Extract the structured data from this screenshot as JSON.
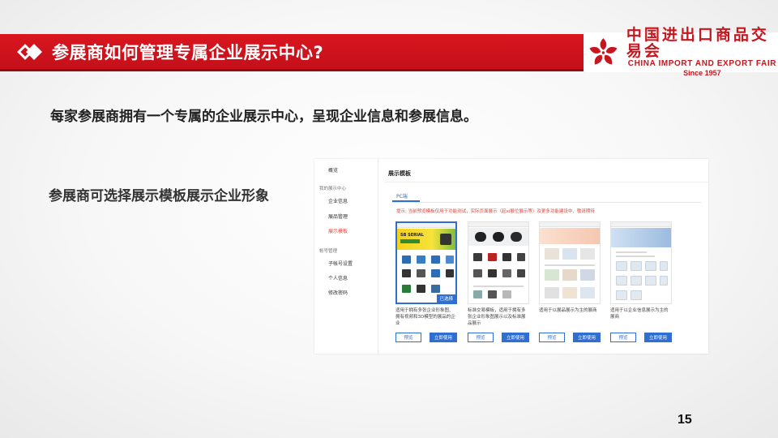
{
  "slide": {
    "title": "参展商如何管理专属企业展示中心?",
    "subtitle": "每家参展商拥有一个专属的企业展示中心，呈现企业信息和参展信息。",
    "side_note": "参展商可选择展示模板展示企业形象",
    "page_number": "15"
  },
  "logo": {
    "cn": "中国进出口商品交易会",
    "en": "CHINA IMPORT AND EXPORT FAIR",
    "since": "Since 1957"
  },
  "colors": {
    "brand_red": "#d9161f",
    "link_blue": "#2f6fd2",
    "tip_red": "#e0453a"
  },
  "screenshot": {
    "nav": {
      "overview": "概览",
      "group_showcase": "我的展示中心",
      "company_info": "企业信息",
      "product_mgmt": "展品管理",
      "display_template": "展示模板",
      "group_account": "帐号管理",
      "sub_accounts": "子帐号设置",
      "personal_info": "个人信息",
      "change_password": "修改密码"
    },
    "panel_title": "展示模板",
    "tab_pc": "PC端",
    "tip": "提示: 当前预览模板仅用于功能测试，实际页面展示（起xi展位展示等）及更多功能建设中，敬请期待",
    "cards": [
      {
        "banner_text": "SB SERIAL",
        "desc": "适用于拥有多张企业形象图、拥有视频和3D模型的展品的企业",
        "badge": "已选择",
        "preview_label": "预览",
        "use_label": "立即使用"
      },
      {
        "desc": "标准交易模板，适用于拥有多张企业形象图展示以及标准展品展示",
        "preview_label": "预览",
        "use_label": "立即使用"
      },
      {
        "desc": "适用于以展品展示为主的展商",
        "preview_label": "预览",
        "use_label": "立即使用"
      },
      {
        "desc": "适用于以企业信息展示为主的展商",
        "preview_label": "预览",
        "use_label": "立即使用"
      }
    ]
  }
}
